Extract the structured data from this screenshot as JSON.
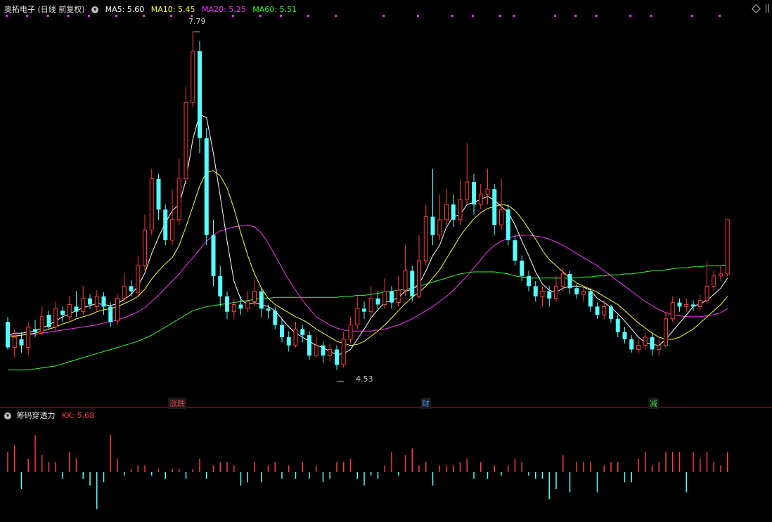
{
  "header": {
    "stock_title": "奥拓电子 (日线 前复权)",
    "ma5": "MA5: 5.60",
    "ma10": "MA10: 5.45",
    "ma20": "MA20: 5.25",
    "ma60": "MA60: 5.51"
  },
  "price_labels": {
    "high": "7.79",
    "low": "4.53"
  },
  "annotations": [
    {
      "text": "涨跌",
      "color": "#e04040"
    },
    {
      "text": "财",
      "color": "#4a8fe0"
    },
    {
      "text": "减",
      "color": "#40d040"
    }
  ],
  "sub_indicator": {
    "name": "筹码穿透力",
    "value": "KK: 5.68"
  },
  "colors": {
    "up": "#ff3b3b",
    "down": "#54ffff",
    "ma5": "#ffffff",
    "ma10": "#ffff33",
    "ma20": "#ff33ff",
    "ma60": "#33ff33",
    "dot": "#ff33ff"
  },
  "chart_data": {
    "type": "candlestick",
    "ylim": [
      4.25,
      7.95
    ],
    "candles": [
      [
        4.95,
        4.7,
        4.68,
        5.0
      ],
      [
        4.7,
        4.8,
        4.6,
        4.88
      ],
      [
        4.78,
        4.72,
        4.65,
        4.85
      ],
      [
        4.7,
        4.9,
        4.62,
        4.95
      ],
      [
        4.88,
        4.85,
        4.8,
        4.97
      ],
      [
        4.85,
        5.0,
        4.82,
        5.1
      ],
      [
        5.02,
        4.9,
        4.88,
        5.06
      ],
      [
        4.9,
        5.08,
        4.86,
        5.15
      ],
      [
        5.06,
        5.02,
        4.95,
        5.1
      ],
      [
        5.0,
        5.12,
        4.96,
        5.2
      ],
      [
        5.1,
        5.05,
        5.0,
        5.25
      ],
      [
        5.05,
        5.18,
        5.02,
        5.3
      ],
      [
        5.18,
        5.12,
        5.08,
        5.22
      ],
      [
        5.1,
        5.2,
        5.05,
        5.26
      ],
      [
        5.2,
        5.1,
        5.02,
        5.24
      ],
      [
        5.1,
        4.95,
        4.9,
        5.14
      ],
      [
        4.96,
        5.18,
        4.92,
        5.22
      ],
      [
        5.18,
        5.3,
        5.15,
        5.42
      ],
      [
        5.3,
        5.25,
        5.2,
        5.36
      ],
      [
        5.24,
        5.5,
        5.2,
        5.6
      ],
      [
        5.5,
        5.85,
        5.45,
        6.0
      ],
      [
        5.85,
        6.35,
        5.8,
        6.45
      ],
      [
        6.35,
        6.05,
        5.95,
        6.4
      ],
      [
        6.05,
        5.75,
        5.7,
        6.1
      ],
      [
        5.75,
        5.95,
        5.7,
        6.25
      ],
      [
        5.95,
        6.35,
        5.9,
        6.55
      ],
      [
        6.35,
        7.1,
        6.3,
        7.25
      ],
      [
        7.1,
        7.6,
        7.05,
        7.79
      ],
      [
        7.6,
        6.75,
        6.6,
        7.7
      ],
      [
        6.75,
        5.8,
        5.7,
        6.85
      ],
      [
        5.8,
        5.4,
        5.3,
        5.95
      ],
      [
        5.4,
        5.2,
        5.1,
        5.5
      ],
      [
        5.2,
        5.05,
        4.98,
        5.25
      ],
      [
        5.05,
        5.12,
        4.98,
        5.18
      ],
      [
        5.12,
        5.08,
        5.02,
        5.2
      ],
      [
        5.08,
        5.15,
        5.05,
        5.25
      ],
      [
        5.15,
        5.25,
        5.1,
        5.35
      ],
      [
        5.25,
        5.08,
        5.0,
        5.28
      ],
      [
        5.08,
        5.06,
        4.98,
        5.12
      ],
      [
        5.06,
        4.92,
        4.88,
        5.1
      ],
      [
        4.92,
        4.8,
        4.75,
        4.98
      ],
      [
        4.8,
        4.72,
        4.66,
        4.86
      ],
      [
        4.72,
        4.88,
        4.7,
        4.95
      ],
      [
        4.88,
        4.82,
        4.75,
        4.92
      ],
      [
        4.82,
        4.62,
        4.58,
        4.86
      ],
      [
        4.62,
        4.72,
        4.6,
        4.8
      ],
      [
        4.72,
        4.62,
        4.55,
        4.76
      ],
      [
        4.62,
        4.68,
        4.56,
        4.74
      ],
      [
        4.68,
        4.53,
        4.48,
        4.72
      ],
      [
        4.53,
        4.78,
        4.5,
        4.85
      ],
      [
        4.78,
        4.92,
        4.74,
        5.0
      ],
      [
        4.92,
        5.08,
        4.88,
        5.2
      ],
      [
        5.08,
        5.05,
        4.98,
        5.15
      ],
      [
        5.05,
        5.18,
        5.0,
        5.3
      ],
      [
        5.18,
        5.12,
        5.06,
        5.25
      ],
      [
        5.12,
        5.25,
        5.08,
        5.38
      ],
      [
        5.25,
        5.14,
        5.08,
        5.3
      ],
      [
        5.14,
        5.26,
        5.1,
        5.4
      ],
      [
        5.26,
        5.45,
        5.2,
        5.7
      ],
      [
        5.45,
        5.2,
        5.15,
        5.5
      ],
      [
        5.2,
        5.55,
        5.18,
        5.8
      ],
      [
        5.55,
        5.98,
        5.5,
        6.1
      ],
      [
        5.98,
        5.8,
        5.7,
        6.45
      ],
      [
        5.8,
        5.95,
        5.75,
        6.2
      ],
      [
        5.95,
        6.1,
        5.9,
        6.25
      ],
      [
        6.1,
        5.95,
        5.88,
        6.2
      ],
      [
        5.95,
        6.15,
        5.9,
        6.35
      ],
      [
        6.15,
        6.32,
        6.1,
        6.7
      ],
      [
        6.32,
        6.1,
        6.0,
        6.4
      ],
      [
        6.1,
        6.2,
        6.05,
        6.3
      ],
      [
        6.2,
        6.25,
        6.1,
        6.45
      ],
      [
        6.25,
        5.9,
        5.8,
        6.3
      ],
      [
        5.9,
        6.05,
        5.85,
        6.35
      ],
      [
        6.05,
        5.75,
        5.7,
        6.1
      ],
      [
        5.75,
        5.55,
        5.5,
        5.8
      ],
      [
        5.55,
        5.4,
        5.35,
        5.6
      ],
      [
        5.4,
        5.3,
        5.25,
        5.45
      ],
      [
        5.3,
        5.2,
        5.15,
        5.35
      ],
      [
        5.2,
        5.25,
        5.1,
        5.3
      ],
      [
        5.25,
        5.18,
        5.1,
        5.3
      ],
      [
        5.18,
        5.3,
        5.15,
        5.4
      ],
      [
        5.3,
        5.42,
        5.25,
        5.48
      ],
      [
        5.42,
        5.28,
        5.22,
        5.45
      ],
      [
        5.28,
        5.22,
        5.18,
        5.32
      ],
      [
        5.22,
        5.25,
        5.15,
        5.3
      ],
      [
        5.25,
        5.1,
        5.05,
        5.28
      ],
      [
        5.1,
        5.02,
        4.98,
        5.14
      ],
      [
        5.02,
        5.1,
        4.98,
        5.16
      ],
      [
        5.1,
        4.98,
        4.94,
        5.12
      ],
      [
        4.98,
        4.85,
        4.8,
        5.02
      ],
      [
        4.85,
        4.78,
        4.74,
        4.9
      ],
      [
        4.78,
        4.68,
        4.65,
        4.82
      ],
      [
        4.68,
        4.72,
        4.64,
        4.78
      ],
      [
        4.72,
        4.8,
        4.68,
        4.84
      ],
      [
        4.8,
        4.68,
        4.62,
        4.84
      ],
      [
        4.68,
        4.72,
        4.62,
        4.78
      ],
      [
        4.72,
        4.98,
        4.7,
        5.05
      ],
      [
        4.98,
        5.14,
        4.95,
        5.2
      ],
      [
        5.14,
        5.1,
        5.05,
        5.18
      ],
      [
        5.1,
        5.12,
        5.05,
        5.18
      ],
      [
        5.12,
        5.1,
        5.06,
        5.16
      ],
      [
        5.1,
        5.16,
        5.06,
        5.22
      ],
      [
        5.16,
        5.3,
        5.12,
        5.55
      ],
      [
        5.3,
        5.4,
        5.25,
        5.45
      ],
      [
        5.4,
        5.42,
        5.35,
        5.5
      ],
      [
        5.42,
        5.95,
        5.4,
        5.95
      ]
    ],
    "ma5": [
      4.82,
      4.84,
      4.84,
      4.85,
      4.86,
      4.89,
      4.92,
      4.96,
      5.0,
      5.03,
      5.06,
      5.09,
      5.11,
      5.13,
      5.12,
      5.11,
      5.13,
      5.17,
      5.22,
      5.3,
      5.43,
      5.62,
      5.78,
      5.92,
      6.04,
      6.1,
      6.34,
      6.74,
      6.98,
      6.95,
      6.6,
      6.18,
      5.74,
      5.35,
      5.17,
      5.12,
      5.14,
      5.12,
      5.1,
      5.06,
      4.98,
      4.9,
      4.84,
      4.8,
      4.76,
      4.72,
      4.7,
      4.66,
      4.63,
      4.64,
      4.68,
      4.78,
      4.88,
      4.99,
      5.07,
      5.14,
      5.16,
      5.19,
      5.25,
      5.27,
      5.32,
      5.45,
      5.6,
      5.7,
      5.88,
      5.98,
      6.0,
      6.1,
      6.12,
      6.15,
      6.18,
      6.14,
      6.08,
      6.02,
      5.9,
      5.74,
      5.6,
      5.44,
      5.32,
      5.26,
      5.24,
      5.28,
      5.3,
      5.3,
      5.29,
      5.26,
      5.18,
      5.14,
      5.09,
      5.03,
      4.96,
      4.88,
      4.8,
      4.75,
      4.73,
      4.72,
      4.78,
      4.86,
      4.94,
      5.02,
      5.1,
      5.13,
      5.16,
      5.22,
      5.28,
      5.38
    ],
    "ma10": [
      4.8,
      4.81,
      4.82,
      4.83,
      4.84,
      4.86,
      4.88,
      4.9,
      4.93,
      4.95,
      4.98,
      5.0,
      5.02,
      5.05,
      5.07,
      5.08,
      5.1,
      5.13,
      5.16,
      5.2,
      5.27,
      5.37,
      5.45,
      5.52,
      5.58,
      5.7,
      5.88,
      6.08,
      6.28,
      6.42,
      6.43,
      6.38,
      6.26,
      6.06,
      5.82,
      5.6,
      5.42,
      5.28,
      5.18,
      5.12,
      5.08,
      5.04,
      5.0,
      4.97,
      4.93,
      4.88,
      4.84,
      4.8,
      4.76,
      4.74,
      4.72,
      4.73,
      4.76,
      4.81,
      4.86,
      4.92,
      4.99,
      5.06,
      5.13,
      5.19,
      5.24,
      5.3,
      5.38,
      5.46,
      5.57,
      5.68,
      5.79,
      5.88,
      5.96,
      6.02,
      6.06,
      6.08,
      6.1,
      6.09,
      6.04,
      5.96,
      5.86,
      5.76,
      5.65,
      5.56,
      5.5,
      5.44,
      5.38,
      5.33,
      5.3,
      5.27,
      5.24,
      5.2,
      5.16,
      5.12,
      5.06,
      5.0,
      4.94,
      4.89,
      4.84,
      4.8,
      4.78,
      4.78,
      4.8,
      4.84,
      4.88,
      4.94,
      5.0,
      5.06,
      5.12,
      5.2
    ],
    "ma20": [
      4.82,
      4.82,
      4.82,
      4.83,
      4.83,
      4.84,
      4.85,
      4.86,
      4.87,
      4.88,
      4.89,
      4.9,
      4.91,
      4.92,
      4.94,
      4.95,
      4.97,
      4.99,
      5.02,
      5.05,
      5.09,
      5.15,
      5.21,
      5.28,
      5.35,
      5.42,
      5.5,
      5.58,
      5.66,
      5.74,
      5.8,
      5.84,
      5.86,
      5.88,
      5.89,
      5.9,
      5.88,
      5.82,
      5.72,
      5.6,
      5.48,
      5.36,
      5.26,
      5.16,
      5.08,
      5.0,
      4.96,
      4.92,
      4.89,
      4.87,
      4.86,
      4.86,
      4.86,
      4.86,
      4.87,
      4.88,
      4.9,
      4.92,
      4.95,
      4.98,
      5.02,
      5.06,
      5.1,
      5.15,
      5.2,
      5.26,
      5.33,
      5.4,
      5.48,
      5.56,
      5.64,
      5.7,
      5.74,
      5.77,
      5.79,
      5.8,
      5.8,
      5.79,
      5.78,
      5.76,
      5.73,
      5.7,
      5.66,
      5.62,
      5.58,
      5.54,
      5.5,
      5.45,
      5.4,
      5.35,
      5.3,
      5.25,
      5.2,
      5.15,
      5.11,
      5.07,
      5.04,
      5.02,
      5.01,
      5.0,
      5.0,
      5.0,
      5.01,
      5.02,
      5.04,
      5.08
    ],
    "ma60": [
      4.48,
      4.48,
      4.48,
      4.48,
      4.49,
      4.5,
      4.51,
      4.52,
      4.54,
      4.56,
      4.58,
      4.6,
      4.62,
      4.64,
      4.66,
      4.68,
      4.7,
      4.72,
      4.74,
      4.76,
      4.79,
      4.82,
      4.86,
      4.9,
      4.94,
      4.98,
      5.02,
      5.06,
      5.08,
      5.1,
      5.11,
      5.12,
      5.13,
      5.14,
      5.15,
      5.16,
      5.17,
      5.18,
      5.18,
      5.19,
      5.19,
      5.19,
      5.19,
      5.19,
      5.19,
      5.19,
      5.19,
      5.19,
      5.19,
      5.2,
      5.2,
      5.21,
      5.21,
      5.22,
      5.23,
      5.24,
      5.25,
      5.26,
      5.27,
      5.28,
      5.3,
      5.32,
      5.34,
      5.36,
      5.38,
      5.4,
      5.42,
      5.43,
      5.44,
      5.44,
      5.44,
      5.44,
      5.43,
      5.42,
      5.4,
      5.39,
      5.38,
      5.38,
      5.38,
      5.38,
      5.38,
      5.38,
      5.38,
      5.38,
      5.39,
      5.39,
      5.4,
      5.4,
      5.41,
      5.41,
      5.42,
      5.42,
      5.43,
      5.44,
      5.45,
      5.45,
      5.46,
      5.47,
      5.48,
      5.48,
      5.49,
      5.49,
      5.5,
      5.5,
      5.5,
      5.51
    ],
    "dot_indices": [
      0,
      3,
      6,
      9,
      12,
      16,
      20,
      24,
      27,
      33,
      37,
      40,
      44,
      48,
      55,
      60,
      65,
      68,
      72,
      74,
      80,
      83,
      86,
      91,
      94,
      100,
      104
    ],
    "sub_values": [
      0.6,
      0.8,
      -0.5,
      0.4,
      1.1,
      0.5,
      0.3,
      0.3,
      -0.2,
      0.6,
      0.4,
      -0.2,
      -0.4,
      -1.1,
      -0.3,
      1.1,
      0.4,
      -0.1,
      0.1,
      0.2,
      0.2,
      -0.1,
      0.1,
      -0.2,
      0.1,
      0.1,
      -0.2,
      0.1,
      0.4,
      -0.2,
      0.2,
      0.3,
      0.3,
      0.2,
      -0.4,
      -0.3,
      0.3,
      -0.3,
      0.2,
      0.3,
      -0.2,
      0.2,
      -0.2,
      0.3,
      -0.2,
      0.2,
      -0.3,
      -0.2,
      0.3,
      0.3,
      0.4,
      -0.2,
      -0.4,
      -0.1,
      -0.2,
      0.2,
      0.6,
      -0.1,
      0.5,
      0.7,
      0.2,
      0.3,
      -0.4,
      0.2,
      0.2,
      0.2,
      0.3,
      0.4,
      -0.2,
      0.3,
      -0.2,
      0.2,
      -0.1,
      0.2,
      0.4,
      0.3,
      -0.1,
      -0.2,
      -0.2,
      -0.8,
      -0.5,
      0.5,
      -0.6,
      0.3,
      0.3,
      0.3,
      -0.6,
      0.2,
      0.3,
      0.3,
      -0.3,
      -0.3,
      0.4,
      0.6,
      0.2,
      0.3,
      0.6,
      0.6,
      0.6,
      -0.6,
      0.6,
      0.4,
      0.6,
      0.3,
      0.2,
      0.6
    ]
  }
}
